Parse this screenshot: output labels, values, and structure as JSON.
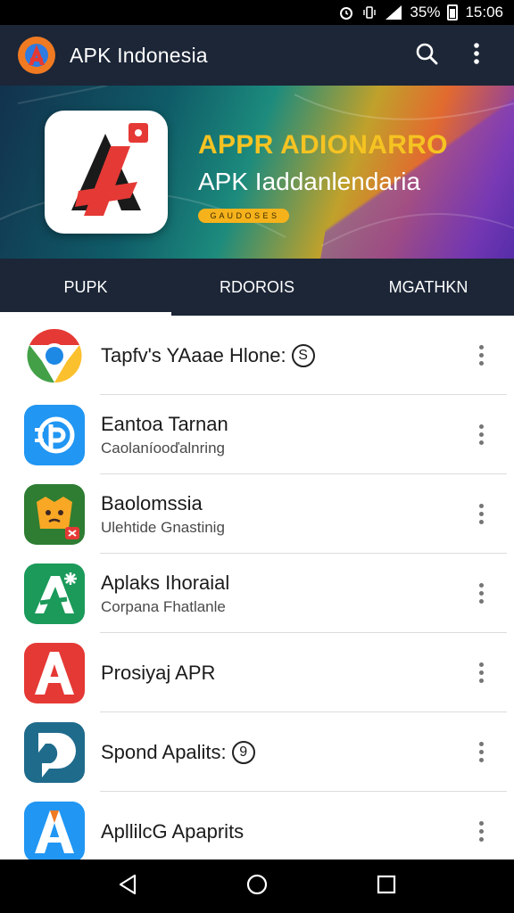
{
  "status_bar": {
    "battery": "35%",
    "time": "15:06",
    "icons": [
      "alarm-icon",
      "vibrate-icon",
      "signal-icon",
      "battery-icon"
    ]
  },
  "app_bar": {
    "title": "APK Indonesia",
    "icons": [
      "app-logo-icon",
      "search-icon",
      "overflow-menu-icon"
    ]
  },
  "banner": {
    "title": "APPR ADIONARRO",
    "subtitle": "APK Iaddanlendaria",
    "pill_text": "G A U D O S E S"
  },
  "tabs": [
    {
      "label": "PUPK",
      "active": true
    },
    {
      "label": "RDOROIS",
      "active": false
    },
    {
      "label": "MGATHKN",
      "active": false
    }
  ],
  "apps": [
    {
      "title": "Tapfv's YAaae Hlone:",
      "badge": "S",
      "subtitle": "",
      "icon": "chrome-like-icon"
    },
    {
      "title": "Eantoa Tarnan",
      "badge": "",
      "subtitle": "Caolaníooďalnring",
      "icon": "blue-p-icon"
    },
    {
      "title": "Baolomssia",
      "badge": "",
      "subtitle": "Ulehtide Gnastinig",
      "icon": "creature-icon"
    },
    {
      "title": "Aplaks Ihoraial",
      "badge": "",
      "subtitle": "Corpana Fhatlanle",
      "icon": "green-a-icon"
    },
    {
      "title": "Prosiyaj APR",
      "badge": "",
      "subtitle": "",
      "icon": "red-a-icon"
    },
    {
      "title": "Spond Apalits:",
      "badge": "9",
      "subtitle": "",
      "icon": "blue-d-icon"
    },
    {
      "title": "ApllilcG Apaprits",
      "badge": "",
      "subtitle": "",
      "icon": "blue-a-icon"
    }
  ],
  "nav_bar": {
    "icons": [
      "back-icon",
      "home-icon",
      "recents-icon"
    ]
  },
  "colors": {
    "toolbar": "#1c2637",
    "banner_title": "#f5c322",
    "accent_red": "#e53935",
    "accent_blue": "#2196f3"
  }
}
